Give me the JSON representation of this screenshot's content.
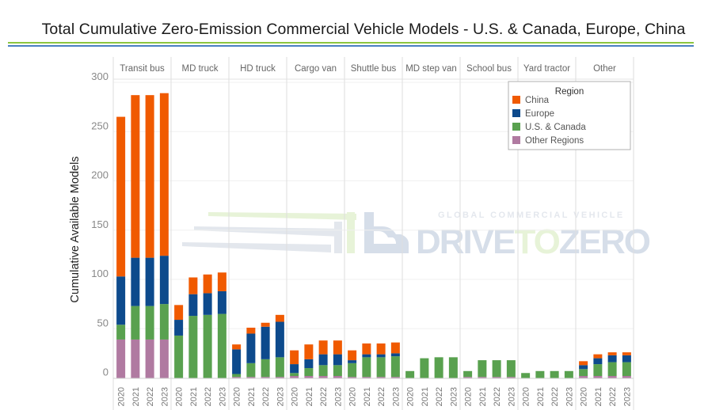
{
  "title": "Total Cumulative Zero-Emission Commercial Vehicle Models - U.S. & Canada, Europe, China",
  "watermark": {
    "line1": "GLOBAL COMMERCIAL VEHICLE",
    "part1": "DRIVE",
    "part2": "TO",
    "part3": "ZERO"
  },
  "colors": {
    "China": "#f05a00",
    "Europe": "#0d4a8c",
    "U.S. & Canada": "#59a14f",
    "Other Regions": "#b07aa1",
    "title_rule_green": "#8cc63f",
    "title_rule_blue": "#4a7fc1"
  },
  "chart_data": {
    "type": "bar",
    "stacked": true,
    "title": "Total Cumulative Zero-Emission Commercial Vehicle Models - U.S. & Canada, Europe, China",
    "xlabel": "",
    "ylabel": "Cumulative Available Models",
    "ylim": [
      0,
      300
    ],
    "yticks": [
      0,
      50,
      100,
      150,
      200,
      250,
      300
    ],
    "grid": true,
    "legend": {
      "title": "Region",
      "position": "top-right",
      "entries": [
        "China",
        "Europe",
        "U.S. & Canada",
        "Other Regions"
      ]
    },
    "years": [
      "2020",
      "2021",
      "2022",
      "2023"
    ],
    "stack_order": [
      "Other Regions",
      "U.S. & Canada",
      "Europe",
      "China"
    ],
    "groups": [
      {
        "name": "Transit bus",
        "series": {
          "Other Regions": [
            39,
            39,
            39,
            39
          ],
          "U.S. & Canada": [
            15,
            34,
            34,
            36
          ],
          "Europe": [
            49,
            49,
            49,
            49
          ],
          "China": [
            162,
            165,
            165,
            165
          ]
        }
      },
      {
        "name": "MD truck",
        "series": {
          "Other Regions": [
            0,
            0,
            0,
            0
          ],
          "U.S. & Canada": [
            43,
            63,
            64,
            65
          ],
          "Europe": [
            16,
            22,
            22,
            23
          ],
          "China": [
            15,
            17,
            19,
            19
          ]
        }
      },
      {
        "name": "HD truck",
        "series": {
          "Other Regions": [
            1,
            1,
            1,
            1
          ],
          "U.S. & Canada": [
            3,
            14,
            18,
            20
          ],
          "Europe": [
            25,
            30,
            33,
            36
          ],
          "China": [
            5,
            6,
            4,
            7
          ]
        }
      },
      {
        "name": "Cargo van",
        "series": {
          "Other Regions": [
            2,
            2,
            2,
            2
          ],
          "U.S. & Canada": [
            3,
            8,
            11,
            11
          ],
          "Europe": [
            9,
            9,
            11,
            11
          ],
          "China": [
            14,
            15,
            14,
            14
          ]
        }
      },
      {
        "name": "Shuttle bus",
        "series": {
          "Other Regions": [
            1,
            1,
            1,
            1
          ],
          "U.S. & Canada": [
            14,
            20,
            20,
            21
          ],
          "Europe": [
            3,
            3,
            3,
            3
          ],
          "China": [
            10,
            11,
            11,
            11
          ]
        }
      },
      {
        "name": "MD step van",
        "series": {
          "Other Regions": [
            0,
            0,
            0,
            0
          ],
          "U.S. & Canada": [
            7,
            20,
            21,
            21
          ],
          "Europe": [
            0,
            0,
            0,
            0
          ],
          "China": [
            0,
            0,
            0,
            0
          ]
        }
      },
      {
        "name": "School bus",
        "series": {
          "Other Regions": [
            1,
            1,
            1,
            1
          ],
          "U.S. & Canada": [
            6,
            17,
            17,
            17
          ],
          "Europe": [
            0,
            0,
            0,
            0
          ],
          "China": [
            0,
            0,
            0,
            0
          ]
        }
      },
      {
        "name": "Yard tractor",
        "series": {
          "Other Regions": [
            0,
            0,
            0,
            0
          ],
          "U.S. & Canada": [
            5,
            7,
            7,
            7
          ],
          "Europe": [
            0,
            0,
            0,
            0
          ],
          "China": [
            0,
            0,
            0,
            0
          ]
        }
      },
      {
        "name": "Other",
        "series": {
          "Other Regions": [
            2,
            2,
            2,
            2
          ],
          "U.S. & Canada": [
            7,
            12,
            14,
            14
          ],
          "Europe": [
            4,
            6,
            7,
            7
          ],
          "China": [
            4,
            4,
            3,
            3
          ]
        }
      }
    ]
  }
}
